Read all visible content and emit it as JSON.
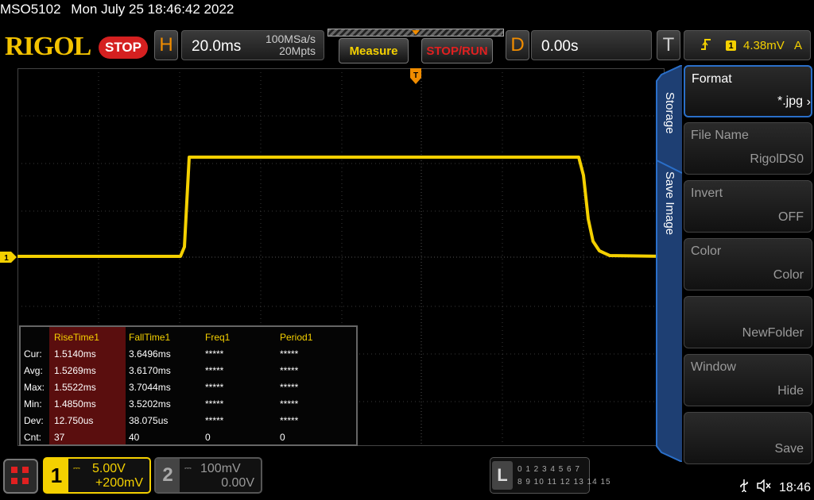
{
  "header": {
    "model": "MSO5102",
    "datetime": "Mon July 25 18:46:42 2022",
    "logo": "RIGOL",
    "run_state": "STOP"
  },
  "horizontal": {
    "key": "H",
    "timebase": "20.0ms",
    "sample_rate": "100MSa/s",
    "memory_depth": "20Mpts"
  },
  "buttons": {
    "measure": "Measure",
    "stop_run": "STOP/RUN"
  },
  "delay": {
    "key": "D",
    "value": "0.00s"
  },
  "trigger": {
    "key": "T",
    "edge_icon": "rising-edge-icon",
    "source": "1",
    "level": "4.38mV",
    "mode": "A"
  },
  "channel_marker": "1",
  "measurements": {
    "headers": [
      "RiseTime1",
      "FallTime1",
      "Freq1",
      "Period1"
    ],
    "rows": [
      {
        "label": "Cur:",
        "values": [
          "1.5140ms",
          "3.6496ms",
          "*****",
          "*****"
        ]
      },
      {
        "label": "Avg:",
        "values": [
          "1.5269ms",
          "3.6170ms",
          "*****",
          "*****"
        ]
      },
      {
        "label": "Max:",
        "values": [
          "1.5522ms",
          "3.7044ms",
          "*****",
          "*****"
        ]
      },
      {
        "label": "Min:",
        "values": [
          "1.4850ms",
          "3.5202ms",
          "*****",
          "*****"
        ]
      },
      {
        "label": "Dev:",
        "values": [
          "12.750us",
          "38.075us",
          "*****",
          "*****"
        ]
      },
      {
        "label": "Cnt:",
        "values": [
          "37",
          "40",
          "0",
          "0"
        ]
      }
    ]
  },
  "side_menu": {
    "tab_storage": "Storage",
    "tab_save_image": "Save Image",
    "items": [
      {
        "label": "Format",
        "value": "*.jpg"
      },
      {
        "label": "File Name",
        "value": "RigolDS0"
      },
      {
        "label": "Invert",
        "value": "OFF"
      },
      {
        "label": "Color",
        "value": "Color"
      },
      {
        "label": "",
        "value": "NewFolder"
      },
      {
        "label": "Window",
        "value": "Hide"
      },
      {
        "label": "",
        "value": "Save"
      }
    ]
  },
  "channels": {
    "ch1": {
      "num": "1",
      "scale": "5.00V",
      "offset": "+200mV"
    },
    "ch2": {
      "num": "2",
      "scale": "100mV",
      "offset": "0.00V"
    }
  },
  "logic": {
    "key": "L",
    "row1": "0 1 2 3  4 5 6 7",
    "row2": "8 9 10 11 12 13 14 15"
  },
  "status_bar": {
    "time": "18:46"
  },
  "colors": {
    "ch1": "#f4d000",
    "accent": "#f08c00",
    "stop": "#d52020",
    "menu_border": "#2a6fc9"
  }
}
